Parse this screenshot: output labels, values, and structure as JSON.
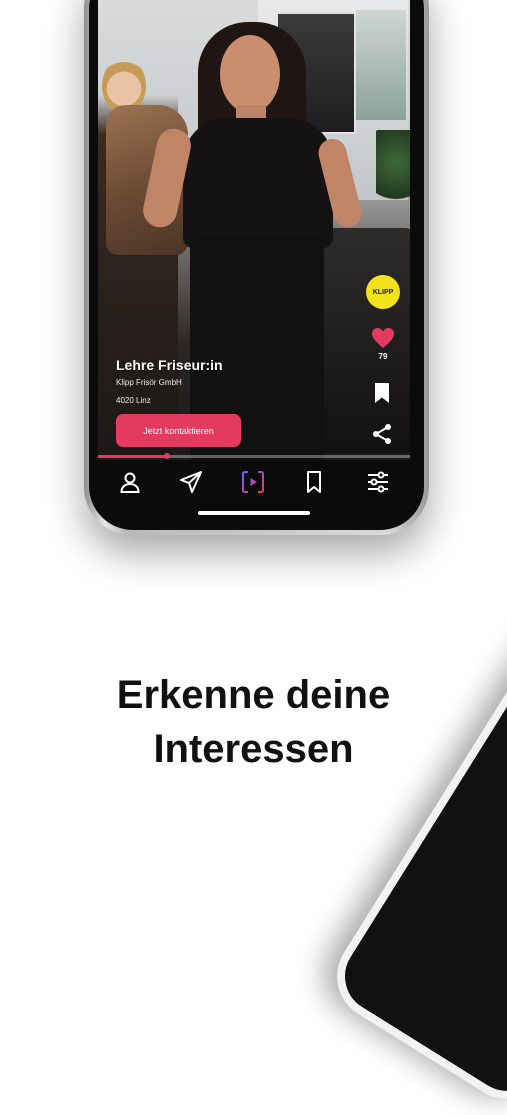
{
  "video": {
    "title": "Lehre Friseur:in",
    "company": "Klipp Frisör GmbH",
    "location": "4020 Linz",
    "cta_label": "Jetzt kontaktieren",
    "brand_badge": "KLIPP",
    "likes": "79",
    "progress": 0.22
  },
  "nav": {
    "items": [
      {
        "name": "profile",
        "icon": "person-icon"
      },
      {
        "name": "messages",
        "icon": "paper-plane-icon"
      },
      {
        "name": "feed",
        "icon": "video-play-icon",
        "active": true
      },
      {
        "name": "saved",
        "icon": "bookmark-icon"
      },
      {
        "name": "filters",
        "icon": "sliders-icon"
      }
    ]
  },
  "colors": {
    "accent": "#e23b5f",
    "badge": "#f1e21a",
    "active_nav_start": "#7b5cff",
    "active_nav_end": "#e23b5f"
  },
  "headline": {
    "line1": "Erkenne deine",
    "line2": "Interessen"
  }
}
